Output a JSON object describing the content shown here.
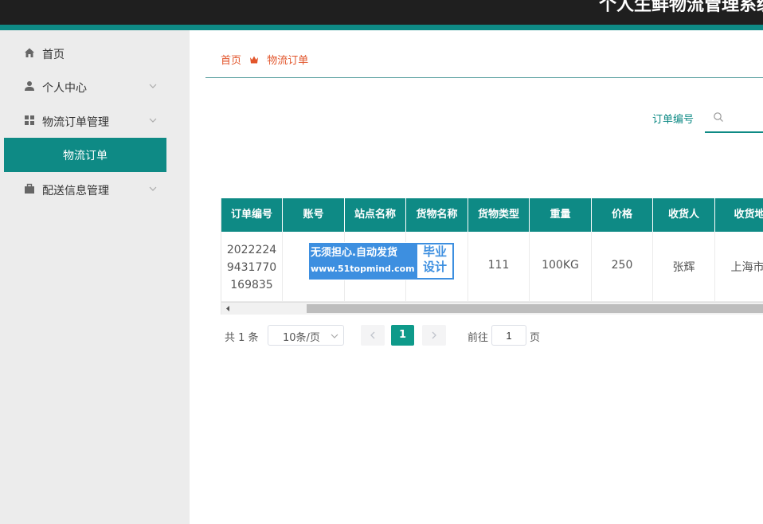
{
  "header": {
    "title": "个人生鲜物流管理系统"
  },
  "sidebar": {
    "items": [
      {
        "label": "首页",
        "icon": "home-icon"
      },
      {
        "label": "个人中心",
        "icon": "user-icon"
      },
      {
        "label": "物流订单管理",
        "icon": "grid-icon"
      },
      {
        "label": "配送信息管理",
        "icon": "briefcase-icon"
      }
    ],
    "active_sub": "物流订单"
  },
  "breadcrumb": {
    "home": "首页",
    "current": "物流订单"
  },
  "search": {
    "label": "订单编号",
    "value": ""
  },
  "table": {
    "headers": [
      "订单编号",
      "账号",
      "站点名称",
      "货物名称",
      "货物类型",
      "重量",
      "价格",
      "收货人",
      "收货地址"
    ],
    "rows": [
      [
        "20222249431770169835",
        "",
        "",
        "",
        "111",
        "100KG",
        "250",
        "张辉",
        "上海市"
      ]
    ]
  },
  "watermark": {
    "line1": "无须担心.自动发货",
    "line2": "www.51topmind.com",
    "right1": "毕业",
    "right2": "设计"
  },
  "pagination": {
    "total": "共 1 条",
    "page_size": "10条/页",
    "current": "1",
    "goto": "前往",
    "goto_value": "1",
    "page_suffix": "页"
  },
  "colors": {
    "primary": "#0e8a85",
    "breadcrumb": "#e2552b",
    "topbar": "#1f1f1f",
    "sidebar_bg": "#ececec",
    "watermark": "#3d8fe0"
  }
}
